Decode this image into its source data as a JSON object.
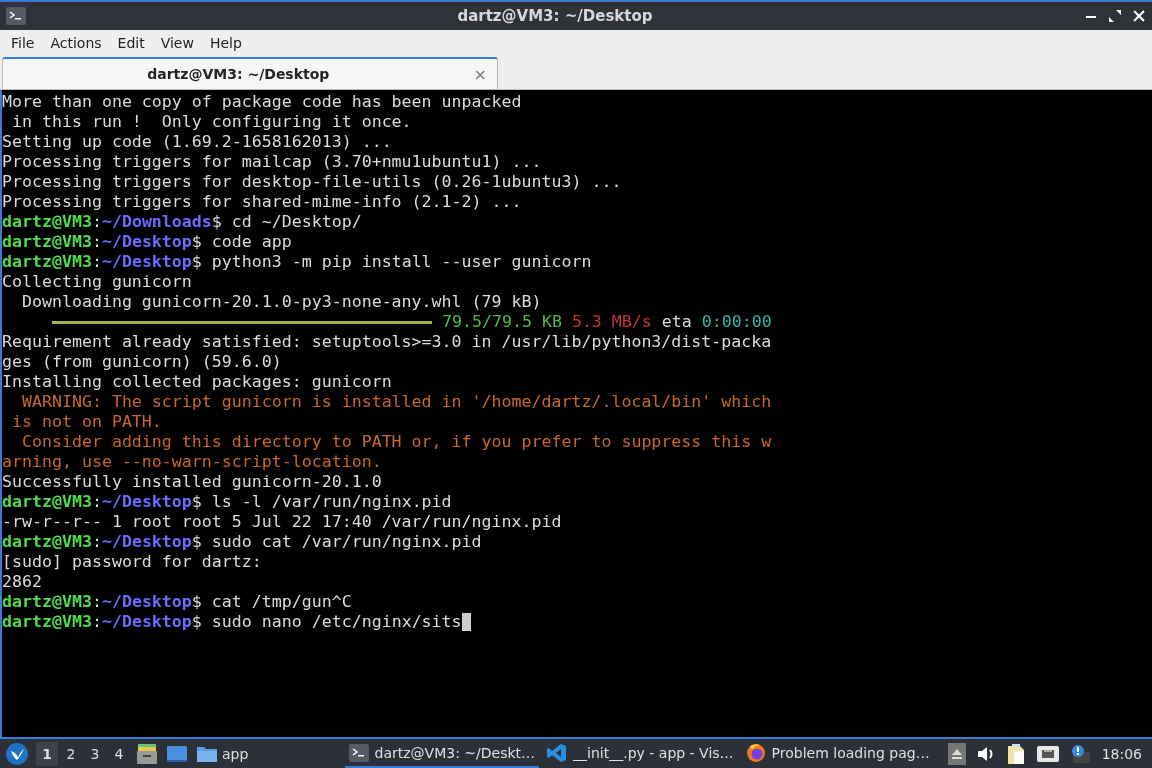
{
  "window": {
    "title": "dartz@VM3: ~/Desktop"
  },
  "menu": [
    "File",
    "Actions",
    "Edit",
    "View",
    "Help"
  ],
  "tabs": [
    {
      "label": "dartz@VM3: ~/Desktop",
      "selected": true,
      "close": "×"
    }
  ],
  "terminal": {
    "lines": [
      [
        {
          "kind": "plain",
          "text": "More than one copy of package code has been unpacked"
        }
      ],
      [
        {
          "kind": "plain",
          "text": " in this run !  Only configuring it once."
        }
      ],
      [
        {
          "kind": "plain",
          "text": "Setting up code (1.69.2-1658162013) ..."
        }
      ],
      [
        {
          "kind": "plain",
          "text": "Processing triggers for mailcap (3.70+nmu1ubuntu1) ..."
        }
      ],
      [
        {
          "kind": "plain",
          "text": "Processing triggers for desktop-file-utils (0.26-1ubuntu3) ..."
        }
      ],
      [
        {
          "kind": "plain",
          "text": "Processing triggers for shared-mime-info (2.1-2) ..."
        }
      ],
      [
        {
          "kind": "user",
          "text": "dartz@VM3"
        },
        {
          "kind": "plain",
          "text": ":"
        },
        {
          "kind": "path",
          "text": "~/Downloads"
        },
        {
          "kind": "plain",
          "text": "$ cd ~/Desktop/"
        }
      ],
      [
        {
          "kind": "user",
          "text": "dartz@VM3"
        },
        {
          "kind": "plain",
          "text": ":"
        },
        {
          "kind": "path",
          "text": "~/Desktop"
        },
        {
          "kind": "plain",
          "text": "$ code app"
        }
      ],
      [
        {
          "kind": "user",
          "text": "dartz@VM3"
        },
        {
          "kind": "plain",
          "text": ":"
        },
        {
          "kind": "path",
          "text": "~/Desktop"
        },
        {
          "kind": "plain",
          "text": "$ python3 -m pip install --user gunicorn"
        }
      ],
      [
        {
          "kind": "plain",
          "text": "Collecting gunicorn"
        }
      ],
      [
        {
          "kind": "plain",
          "text": "  Downloading gunicorn-20.1.0-py3-none-any.whl (79 kB)"
        }
      ],
      [
        {
          "kind": "bar",
          "level": 1
        },
        {
          "kind": "size",
          "text": "79.5/79.5 KB"
        },
        {
          "kind": "speed",
          "text": "5.3 MB/s"
        },
        {
          "kind": "plain",
          "text": "eta"
        },
        {
          "kind": "eta",
          "text": "0:00:00"
        }
      ],
      [
        {
          "kind": "plain",
          "text": "Requirement already satisfied: setuptools>=3.0 in /usr/lib/python3/dist-packa"
        }
      ],
      [
        {
          "kind": "plain",
          "text": "ges (from gunicorn) (59.6.0)"
        }
      ],
      [
        {
          "kind": "plain",
          "text": "Installing collected packages: gunicorn"
        }
      ],
      [
        {
          "kind": "warning",
          "text": "  WARNING: The script gunicorn is installed in '/home/dartz/.local/bin' which"
        }
      ],
      [
        {
          "kind": "warning",
          "text": " is not on PATH."
        }
      ],
      [
        {
          "kind": "warning",
          "text": "  Consider adding this directory to PATH or, if you prefer to suppress this w"
        }
      ],
      [
        {
          "kind": "warning",
          "text": "arning, use --no-warn-script-location."
        }
      ],
      [
        {
          "kind": "plain",
          "text": "Successfully installed gunicorn-20.1.0"
        }
      ],
      [
        {
          "kind": "user",
          "text": "dartz@VM3"
        },
        {
          "kind": "plain",
          "text": ":"
        },
        {
          "kind": "path",
          "text": "~/Desktop"
        },
        {
          "kind": "plain",
          "text": "$ ls -l /var/run/nginx.pid"
        }
      ],
      [
        {
          "kind": "plain",
          "text": "-rw-r--r-- 1 root root 5 Jul 22 17:40 /var/run/nginx.pid"
        }
      ],
      [
        {
          "kind": "user",
          "text": "dartz@VM3"
        },
        {
          "kind": "plain",
          "text": ":"
        },
        {
          "kind": "path",
          "text": "~/Desktop"
        },
        {
          "kind": "plain",
          "text": "$ sudo cat /var/run/nginx.pid"
        }
      ],
      [
        {
          "kind": "plain",
          "text": "[sudo] password for dartz:"
        }
      ],
      [
        {
          "kind": "plain",
          "text": "2862"
        }
      ],
      [
        {
          "kind": "user",
          "text": "dartz@VM3"
        },
        {
          "kind": "plain",
          "text": ":"
        },
        {
          "kind": "path",
          "text": "~/Desktop"
        },
        {
          "kind": "plain",
          "text": "$ cat /tmp/gun^C"
        }
      ],
      [
        {
          "kind": "user",
          "text": "dartz@VM3"
        },
        {
          "kind": "plain",
          "text": ":"
        },
        {
          "kind": "path",
          "text": "~/Desktop"
        },
        {
          "kind": "plain",
          "text": "$ sudo nano /etc/nginx/sits"
        },
        {
          "kind": "cursor"
        }
      ]
    ]
  },
  "taskbar": {
    "workspaces": [
      {
        "label": "1",
        "selected": true
      },
      {
        "label": "2",
        "selected": false
      },
      {
        "label": "3",
        "selected": false
      },
      {
        "label": "4",
        "selected": false
      }
    ],
    "launchers": [
      {
        "kind": "cabinet"
      },
      {
        "kind": "window"
      },
      {
        "kind": "folder",
        "label": "app"
      }
    ],
    "tasks": [
      {
        "kind": "terminal",
        "label": "dartz@VM3: ~/Deskt…",
        "selected": true
      },
      {
        "kind": "code",
        "label": "__init__.py - app - Vis…",
        "selected": false
      },
      {
        "kind": "browser",
        "label": "Problem loading pag…",
        "selected": false
      }
    ],
    "tray": [
      {
        "kind": "eject"
      },
      {
        "kind": "volume"
      },
      {
        "kind": "clipboard"
      },
      {
        "kind": "network"
      },
      {
        "kind": "alert"
      }
    ],
    "clock": "18:06"
  }
}
